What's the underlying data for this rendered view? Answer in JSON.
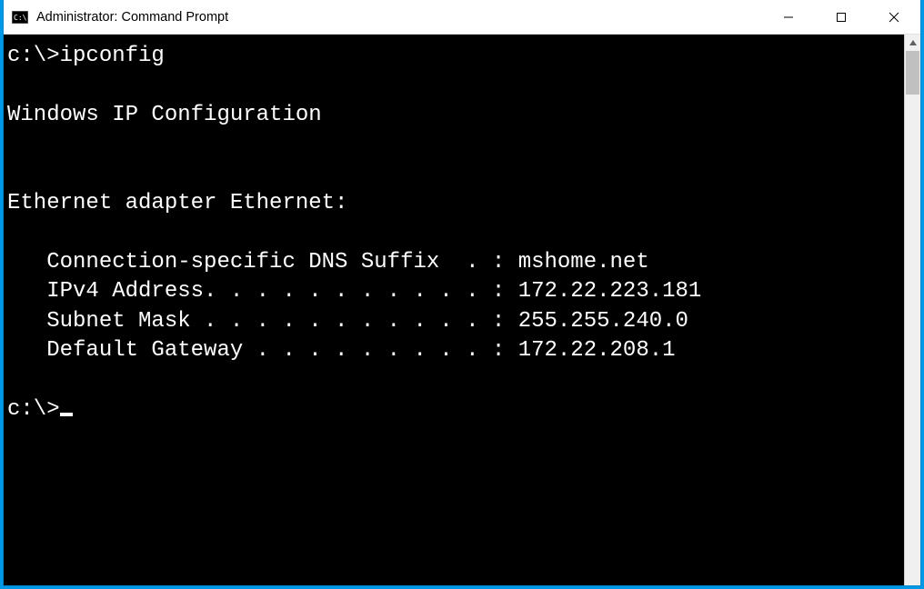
{
  "window": {
    "title": "Administrator: Command Prompt"
  },
  "terminal": {
    "prompt1": "c:\\>",
    "command1": "ipconfig",
    "blank1": "",
    "header": "Windows IP Configuration",
    "blank2": "",
    "blank3": "",
    "adapter": "Ethernet adapter Ethernet:",
    "blank4": "",
    "dns_line": "   Connection-specific DNS Suffix  . : mshome.net",
    "ipv4_line": "   IPv4 Address. . . . . . . . . . . : 172.22.223.181",
    "subnet_line": "   Subnet Mask . . . . . . . . . . . : 255.255.240.0",
    "gateway_line": "   Default Gateway . . . . . . . . . : 172.22.208.1",
    "blank5": "",
    "prompt2": "c:\\>"
  }
}
